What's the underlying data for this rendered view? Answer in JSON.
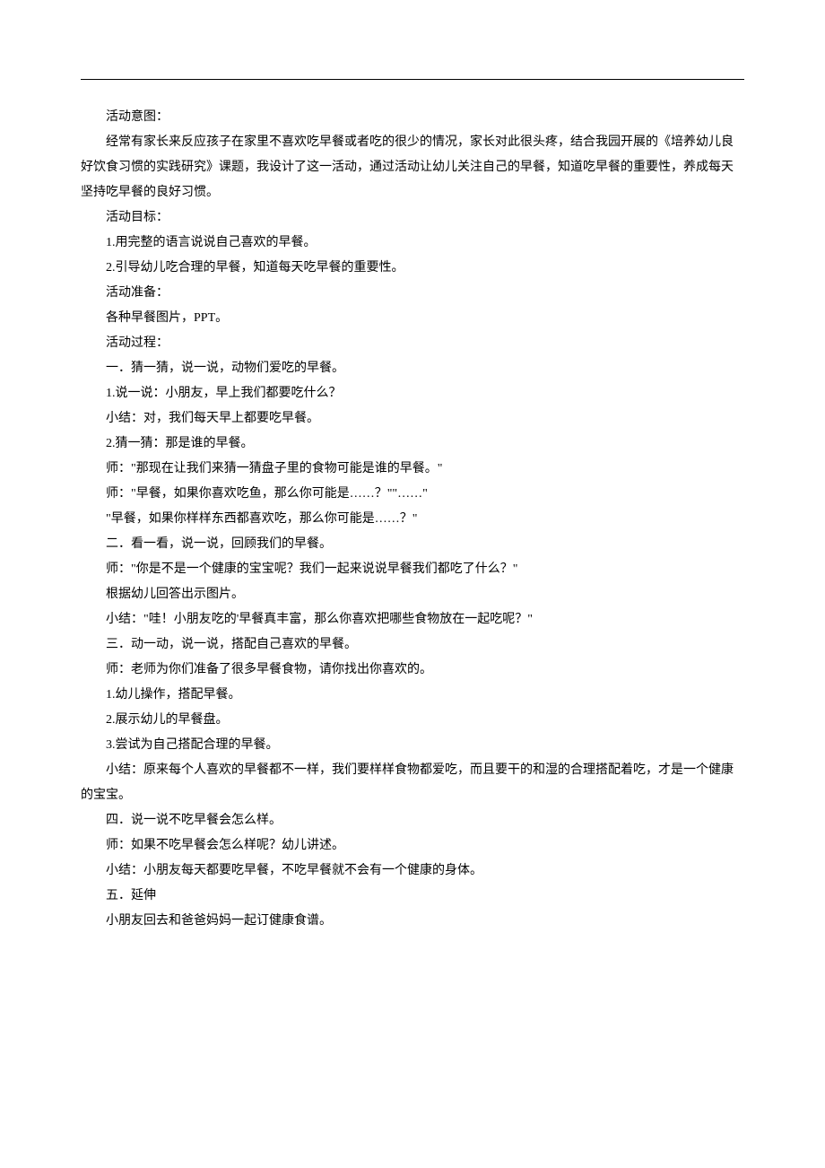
{
  "lines": [
    {
      "text": "活动意图：",
      "indent": true
    },
    {
      "text": "经常有家长来反应孩子在家里不喜欢吃早餐或者吃的很少的情况，家长对此很头疼，结合我园开展的《培养幼儿良好饮食习惯的实践研究》课题，我设计了这一活动，通过活动让幼儿关注自己的早餐，知道吃早餐的重要性，养成每天坚持吃早餐的良好习惯。",
      "indent": true
    },
    {
      "text": "活动目标：",
      "indent": true
    },
    {
      "text": "1.用完整的语言说说自己喜欢的早餐。",
      "indent": true
    },
    {
      "text": "2.引导幼儿吃合理的早餐，知道每天吃早餐的重要性。",
      "indent": true
    },
    {
      "text": "活动准备：",
      "indent": true
    },
    {
      "text": "各种早餐图片，PPT。",
      "indent": true
    },
    {
      "text": "活动过程：",
      "indent": true
    },
    {
      "text": "一．猜一猜，说一说，动物们爱吃的早餐。",
      "indent": true
    },
    {
      "text": "1.说一说：小朋友，早上我们都要吃什么？",
      "indent": true
    },
    {
      "text": "小结：对，我们每天早上都要吃早餐。",
      "indent": true
    },
    {
      "text": "2.猜一猜：那是谁的早餐。",
      "indent": true
    },
    {
      "text": "师：\"那现在让我们来猜一猜盘子里的食物可能是谁的早餐。\"",
      "indent": true
    },
    {
      "text": "师：\"早餐，如果你喜欢吃鱼，那么你可能是……？\"\"……\"",
      "indent": true
    },
    {
      "text": "\"早餐，如果你样样东西都喜欢吃，那么你可能是……？\"",
      "indent": true
    },
    {
      "text": "二．看一看，说一说，回顾我们的早餐。",
      "indent": true
    },
    {
      "text": "师：\"你是不是一个健康的宝宝呢？我们一起来说说早餐我们都吃了什么？\"",
      "indent": true
    },
    {
      "text": "根据幼儿回答出示图片。",
      "indent": true
    },
    {
      "text": "小结：\"哇！小朋友吃的'早餐真丰富，那么你喜欢把哪些食物放在一起吃呢？\"",
      "indent": true
    },
    {
      "text": "三．动一动，说一说，搭配自己喜欢的早餐。",
      "indent": true
    },
    {
      "text": "师：老师为你们准备了很多早餐食物，请你找出你喜欢的。",
      "indent": true
    },
    {
      "text": "1.幼儿操作，搭配早餐。",
      "indent": true
    },
    {
      "text": "2.展示幼儿的早餐盘。",
      "indent": true
    },
    {
      "text": "3.尝试为自己搭配合理的早餐。",
      "indent": true
    },
    {
      "text": "小结：原来每个人喜欢的早餐都不一样，我们要样样食物都爱吃，而且要干的和湿的合理搭配着吃，才是一个健康的宝宝。",
      "indent": true
    },
    {
      "text": "四．说一说不吃早餐会怎么样。",
      "indent": true
    },
    {
      "text": "师：如果不吃早餐会怎么样呢？幼儿讲述。",
      "indent": true
    },
    {
      "text": "小结：小朋友每天都要吃早餐，不吃早餐就不会有一个健康的身体。",
      "indent": true
    },
    {
      "text": "五．延伸",
      "indent": true
    },
    {
      "text": "小朋友回去和爸爸妈妈一起订健康食谱。",
      "indent": true
    }
  ]
}
